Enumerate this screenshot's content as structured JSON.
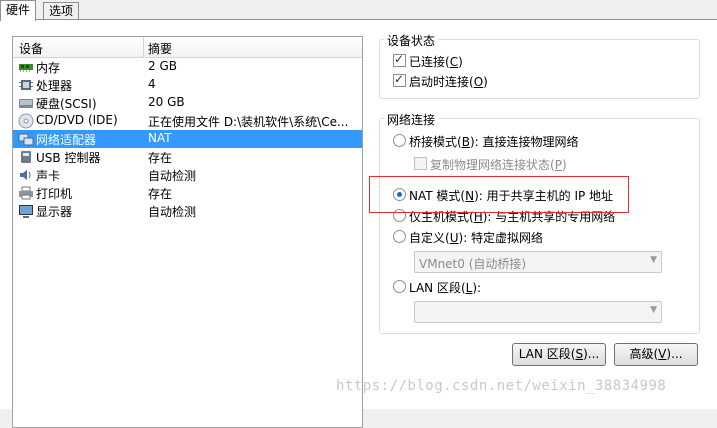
{
  "tabs": [
    {
      "label": "硬件"
    },
    {
      "label": "选项"
    }
  ],
  "device_list": {
    "col_device": "设备",
    "col_summary": "摘要",
    "rows": [
      {
        "name": "内存",
        "summary": "2 GB",
        "icon": "memory-icon"
      },
      {
        "name": "处理器",
        "summary": "4",
        "icon": "processor-icon"
      },
      {
        "name": "硬盘(SCSI)",
        "summary": "20 GB",
        "icon": "hard-disk-icon"
      },
      {
        "name": "CD/DVD (IDE)",
        "summary": "正在使用文件 D:\\装机软件\\系统\\Ce...",
        "icon": "cd-dvd-icon"
      },
      {
        "name": "网络适配器",
        "summary": "NAT",
        "icon": "network-adapter-icon",
        "selected": true
      },
      {
        "name": "USB 控制器",
        "summary": "存在",
        "icon": "usb-icon"
      },
      {
        "name": "声卡",
        "summary": "自动检测",
        "icon": "sound-card-icon"
      },
      {
        "name": "打印机",
        "summary": "存在",
        "icon": "printer-icon"
      },
      {
        "name": "显示器",
        "summary": "自动检测",
        "icon": "display-icon"
      }
    ]
  },
  "device_status": {
    "title": "设备状态",
    "connected": {
      "label": "已连接",
      "key": "C",
      "checked": true
    },
    "connect_on_power": {
      "label": "启动时连接",
      "key": "O",
      "checked": true
    }
  },
  "network_connection": {
    "title": "网络连接",
    "bridged": {
      "label": "桥接模式",
      "key": "B",
      "desc": ": 直接连接物理网络"
    },
    "replicate": {
      "label": "复制物理网络连接状态",
      "key": "P"
    },
    "nat": {
      "label": "NAT 模式",
      "key": "N",
      "desc": ": 用于共享主机的 IP 地址",
      "selected": true
    },
    "host_only": {
      "label": "仅主机模式",
      "key": "H",
      "desc": ": 与主机共享的专用网络"
    },
    "custom": {
      "label": "自定义",
      "key": "U",
      "desc": ": 特定虚拟网络"
    },
    "custom_value": "VMnet0 (自动桥接)",
    "lan_segment": {
      "label": "LAN 区段",
      "key": "L",
      "desc": ":"
    },
    "lan_value": ""
  },
  "buttons": {
    "lan_segments": {
      "label": "LAN 区段",
      "key": "S",
      "tail": "..."
    },
    "advanced": {
      "label": "高级",
      "key": "V",
      "tail": "..."
    }
  },
  "watermark": "https://blog.csdn.net/weixin_38834998"
}
